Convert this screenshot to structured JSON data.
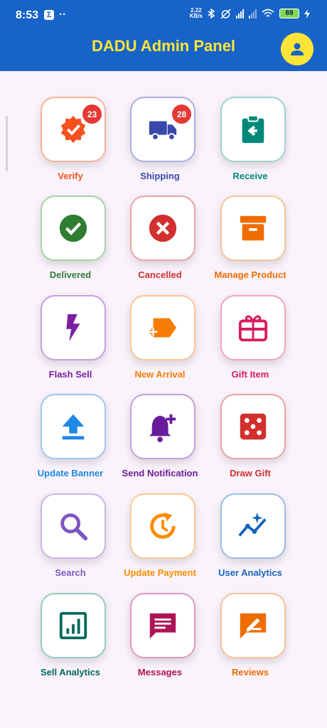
{
  "status_bar": {
    "time": "8:53",
    "notification_letter": "Σ",
    "dots": "··",
    "net_speed_value": "2.22",
    "net_speed_unit": "KB/s",
    "battery": "69"
  },
  "header": {
    "title": "DADU Admin Panel"
  },
  "colors": {
    "appbar": "#1763c7",
    "title": "#ffe438",
    "avatar": "#ffe438",
    "background": "#fbf3fb",
    "badge": "#e53935"
  },
  "tiles": [
    {
      "label": "Verify",
      "icon": "verified-badge-icon",
      "color": "#f4511e",
      "border": "#f8b39a",
      "badge": "23"
    },
    {
      "label": "Shipping",
      "icon": "truck-icon",
      "color": "#3949ab",
      "border": "#a9b1e3",
      "badge": "28"
    },
    {
      "label": "Receive",
      "icon": "clipboard-arrow-icon",
      "color": "#00897b",
      "border": "#9fd5cf"
    },
    {
      "label": "Delivered",
      "icon": "check-circle-icon",
      "color": "#2e7d32",
      "border": "#a6d3a9"
    },
    {
      "label": "Cancelled",
      "icon": "cancel-circle-icon",
      "color": "#d32f2f",
      "border": "#eaa3a3"
    },
    {
      "label": "Manage Product",
      "icon": "archive-box-icon",
      "color": "#ef6c00",
      "border": "#f7c39a"
    },
    {
      "label": "Flash Sell",
      "icon": "lightning-icon",
      "color": "#7b1fa2",
      "border": "#c99ee0"
    },
    {
      "label": "New Arrival",
      "icon": "new-label-icon",
      "color": "#f57c00",
      "border": "#f8c898"
    },
    {
      "label": "Gift Item",
      "icon": "gift-card-icon",
      "color": "#d81b60",
      "border": "#f0a6c0"
    },
    {
      "label": "Update Banner",
      "icon": "upload-icon",
      "color": "#1e88e5",
      "border": "#9fc8f2"
    },
    {
      "label": "Send Notification",
      "icon": "bell-plus-icon",
      "color": "#6a1b9a",
      "border": "#c4a0dc"
    },
    {
      "label": "Draw Gift",
      "icon": "dice-icon",
      "color": "#d32f2f",
      "border": "#eaa3a3"
    },
    {
      "label": "Search",
      "icon": "search-icon",
      "color": "#7e57c2",
      "border": "#c8b7e6"
    },
    {
      "label": "Update Payment",
      "icon": "update-clock-icon",
      "color": "#fb8c00",
      "border": "#f9cb91"
    },
    {
      "label": "User Analytics",
      "icon": "analytics-line-icon",
      "color": "#1565c0",
      "border": "#9cbde6"
    },
    {
      "label": "Sell Analytics",
      "icon": "bar-chart-icon",
      "color": "#00695c",
      "border": "#95cbc2"
    },
    {
      "label": "Messages",
      "icon": "message-icon",
      "color": "#ad1457",
      "border": "#e09abd"
    },
    {
      "label": "Reviews",
      "icon": "review-pen-icon",
      "color": "#ef6c00",
      "border": "#f7c39a"
    }
  ]
}
